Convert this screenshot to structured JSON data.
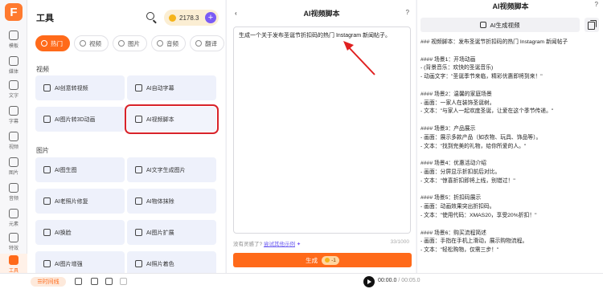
{
  "rail": {
    "logo": "F",
    "items": [
      {
        "label": "模板",
        "icon": "template-icon",
        "active": false
      },
      {
        "label": "媒体",
        "icon": "media-icon",
        "active": false
      },
      {
        "label": "文字",
        "icon": "text-icon",
        "active": false
      },
      {
        "label": "字幕",
        "icon": "subtitle-icon",
        "active": false
      },
      {
        "label": "视频",
        "icon": "video-icon",
        "active": false
      },
      {
        "label": "图片",
        "icon": "image-icon",
        "active": false
      },
      {
        "label": "音频",
        "icon": "audio-icon",
        "active": false
      },
      {
        "label": "元素",
        "icon": "element-icon",
        "active": false
      },
      {
        "label": "特效",
        "icon": "effect-icon",
        "active": false
      },
      {
        "label": "工具",
        "icon": "tools-icon",
        "active": true
      }
    ]
  },
  "tools": {
    "title": "工具",
    "coins": "2178.3",
    "coins_plus": "+",
    "categories": [
      {
        "label": "热门",
        "active": true
      },
      {
        "label": "视频",
        "active": false
      },
      {
        "label": "图片",
        "active": false
      },
      {
        "label": "音频",
        "active": false
      },
      {
        "label": "翻译",
        "active": false
      }
    ],
    "video_section": "视频",
    "video_cards": [
      "AI创意转视频",
      "AI自动字幕",
      "AI图片转3D动画",
      "AI视频脚本"
    ],
    "image_section": "图片",
    "image_cards": [
      "AI图生图",
      "AI文字生成图片",
      "AI老照片修复",
      "AI物体抹除",
      "AI换脸",
      "AI图片扩展",
      "AI图片增强",
      "AI照片着色"
    ]
  },
  "prompt": {
    "title": "AI视频脚本",
    "back": "‹",
    "help": "?",
    "text": "生成一个关于发布圣诞节折扣码的热门 Instagram 新闻帖子。",
    "inspire_text": "没有灵感了?",
    "inspire_link": "尝试其他示例",
    "counter": "33/1000",
    "generate_label": "生成",
    "generate_cost": "-1"
  },
  "result": {
    "title": "AI视频脚本",
    "help": "?",
    "generate_label": "AI生成视频",
    "content": "### 视频脚本：发布圣诞节折扣码的热门 Instagram 新闻帖子\n\n#### 场景1：开场动画\n- (背景音乐：欢快的圣诞音乐)\n- 动画文字：\"圣诞季节来临，精彩优惠即将到来！\"\n\n#### 场景2：温馨的家庭场景\n- 画面：一家人在装饰圣诞树。\n- 文本：\"与家人一起欢度圣诞，让爱在这个季节传递。\"\n\n#### 场景3：产品展示\n- 画面：展示多款产品（如衣物、玩具、饰品等）。\n- 文本：\"找到完美的礼物，给你所爱的人。\"\n\n#### 场景4：优惠活动介绍\n- 画面：分屏显示折扣前后对比。\n- 文本：\"惊喜折扣即将上线，别错过！\"\n\n#### 场景5：折扣码展示\n- 画面：动画效果突出折扣码。\n- 文本：\"使用代码：XMAS20，享受20%折扣！\"\n\n#### 场景6：购买流程简述\n- 画面：手指在手机上滑动，展示购物流程。\n- 文本：\"轻松购物，仅需三步！\""
  },
  "bottom": {
    "timeline": "时间线",
    "time_current": "00:00.0",
    "time_total": "/ 00:05.0"
  },
  "colors": {
    "accent": "#ff6a1a",
    "highlight": "#d8232a",
    "annotation_arrow": "#e02020"
  }
}
